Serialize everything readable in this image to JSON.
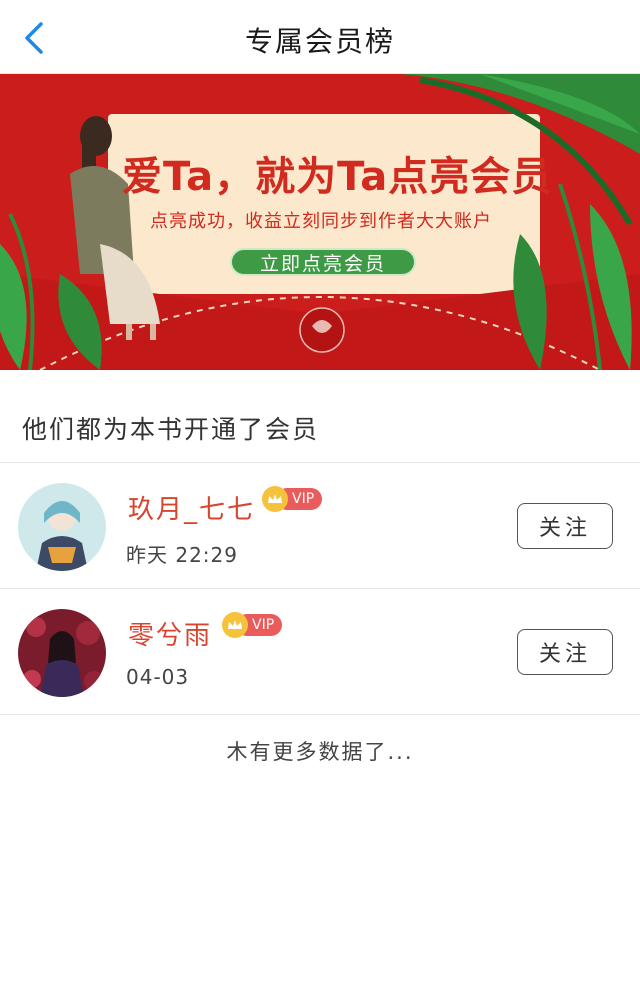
{
  "header": {
    "title": "专属会员榜",
    "back_icon": "chevron-left-icon"
  },
  "banner": {
    "title": "爱Ta，就为Ta点亮会员",
    "subtitle": "点亮成功，收益立刻同步到作者大大账户",
    "cta_label": "立即点亮会员",
    "colors": {
      "background": "#cc1d1d",
      "card": "#fbe8cd",
      "leaf": "#2f8a3a"
    }
  },
  "section": {
    "title": "他们都为本书开通了会员"
  },
  "members": [
    {
      "name": "玖月_七七",
      "badge": "VIP",
      "time": "昨天 22:29",
      "follow_label": "关注"
    },
    {
      "name": "零兮雨",
      "badge": "VIP",
      "time": "04-03",
      "follow_label": "关注"
    }
  ],
  "footer": {
    "no_more_text": "木有更多数据了..."
  },
  "colors": {
    "accent_blue": "#1e88e5",
    "name_red": "#d8452f",
    "vip_red": "#ea5c5c",
    "vip_gold": "#f5c23b"
  }
}
